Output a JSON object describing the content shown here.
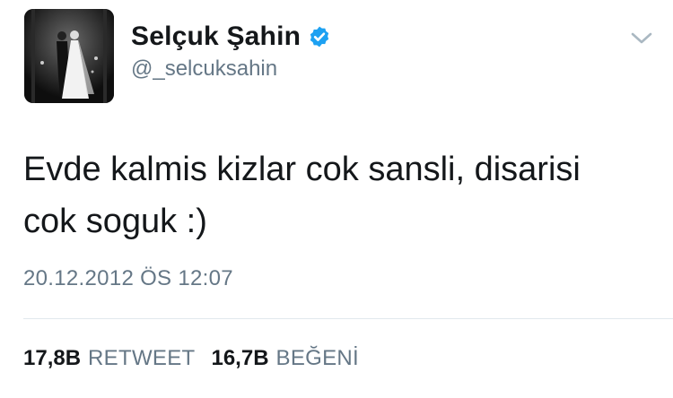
{
  "user": {
    "display_name": "Selçuk Şahin",
    "handle": "@_selcuksahin",
    "verified": true,
    "verified_icon": "verified-badge-icon",
    "avatar_description": "wedding-photo-avatar"
  },
  "tweet": {
    "text": "Evde kalmis kizlar cok sansli, disarisi cok soguk :)",
    "timestamp": "20.12.2012 ÖS 12:07"
  },
  "stats": {
    "retweets_count": "17,8B",
    "retweets_label": "RETWEET",
    "likes_count": "16,7B",
    "likes_label": "BEĞENİ"
  },
  "colors": {
    "verified_blue": "#1da1f2",
    "secondary_text": "#657786",
    "primary_text": "#14171a"
  },
  "menu_icon": "chevron-down-icon"
}
